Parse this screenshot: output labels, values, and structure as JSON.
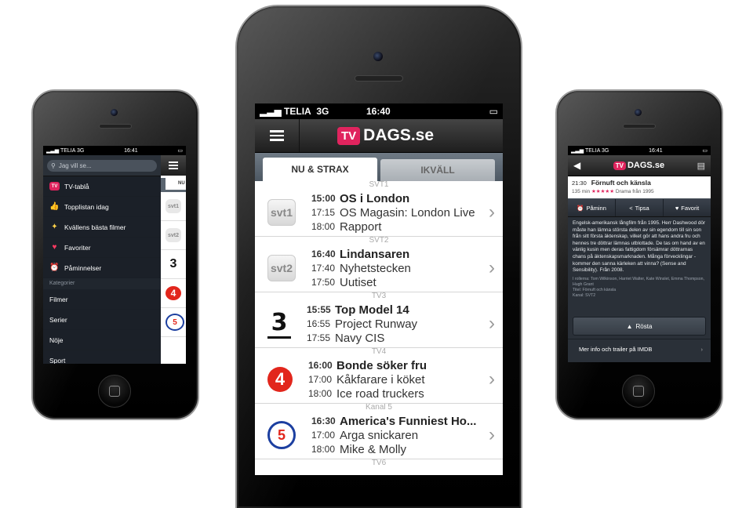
{
  "status": {
    "carrier": "TELIA",
    "network": "3G",
    "time": "16:40",
    "time_small": "16:41"
  },
  "brand": {
    "tv": "TV",
    "name": "DAGS.se"
  },
  "main": {
    "tabs": [
      {
        "label": "NU & STRAX"
      },
      {
        "label": "IKVÄLL"
      }
    ],
    "channels": [
      {
        "header": "SVT1",
        "logo": "svt1",
        "progs": [
          {
            "time": "15:00",
            "title": "OS i London"
          },
          {
            "time": "17:15",
            "title": "OS Magasin: London Live"
          },
          {
            "time": "18:00",
            "title": "Rapport"
          }
        ]
      },
      {
        "header": "SVT2",
        "logo": "svt2",
        "progs": [
          {
            "time": "16:40",
            "title": "Lindansaren"
          },
          {
            "time": "17:40",
            "title": "Nyhetstecken"
          },
          {
            "time": "17:50",
            "title": "Uutiset"
          }
        ]
      },
      {
        "header": "TV3",
        "logo": "3",
        "progs": [
          {
            "time": "15:55",
            "title": "Top Model 14"
          },
          {
            "time": "16:55",
            "title": "Project Runway"
          },
          {
            "time": "17:55",
            "title": "Navy CIS"
          }
        ]
      },
      {
        "header": "TV4",
        "logo": "4",
        "progs": [
          {
            "time": "16:00",
            "title": "Bonde söker fru"
          },
          {
            "time": "17:00",
            "title": "Kåkfarare i köket"
          },
          {
            "time": "18:00",
            "title": "Ice road truckers"
          }
        ]
      },
      {
        "header": "Kanal 5",
        "logo": "5",
        "progs": [
          {
            "time": "16:30",
            "title": "America's Funniest Ho..."
          },
          {
            "time": "17:00",
            "title": "Arga snickaren"
          },
          {
            "time": "18:00",
            "title": "Mike & Molly"
          }
        ]
      }
    ],
    "next_header": "TV6"
  },
  "sidebar": {
    "search_placeholder": "Jag vill se...",
    "items": [
      {
        "label": "TV-tablå"
      },
      {
        "label": "Topplistan idag"
      },
      {
        "label": "Kvällens bästa filmer"
      },
      {
        "label": "Favoriter"
      },
      {
        "label": "Påminnelser"
      }
    ],
    "category_header": "Kategorier",
    "categories": [
      {
        "label": "Filmer"
      },
      {
        "label": "Serier"
      },
      {
        "label": "Nöje"
      },
      {
        "label": "Sport"
      }
    ],
    "peek_tab": "NU",
    "peek_logos": [
      "svt1",
      "svt2",
      "3",
      "4",
      "5"
    ]
  },
  "detail": {
    "time": "21:30",
    "title": "Förnuft och känsla",
    "duration": "135 min",
    "rating_stars": "★★★★★",
    "genre": "Drama från 1995",
    "actions": [
      {
        "label": "Påminn"
      },
      {
        "label": "Tipsa"
      },
      {
        "label": "Favorit"
      }
    ],
    "description": "Engelsk-amerikansk långfilm från 1995. Herr Dashwood dör måste han lämna största delen av sin egendom till sin son från sitt första äktenskap, vilket gör att hans andra fru och hennes tre döttrar lämnas utblottade. De tas om hand av en vänlig kusin men deras fattigdom försämrar döttrarnas chans på äktenskapsmarknaden. Många förvecklingar - kommer den sanna kärleken att vinna? (Sense and Sensibility). Från 2008.",
    "credits": "I rollerna: Tom Wilkinson, Harriet Walter, Kate Winslet, Emma Thompson, Hugh Grant",
    "original_title": "Titel: Förnuft och känsla",
    "channel": "Kanal: SVT2",
    "vote_label": "Rösta",
    "imdb_label": "Mer info och trailer på IMDB"
  },
  "colors": {
    "brand": "#e0245e",
    "dark": "#1b2028",
    "tabs": "#5a6570"
  }
}
